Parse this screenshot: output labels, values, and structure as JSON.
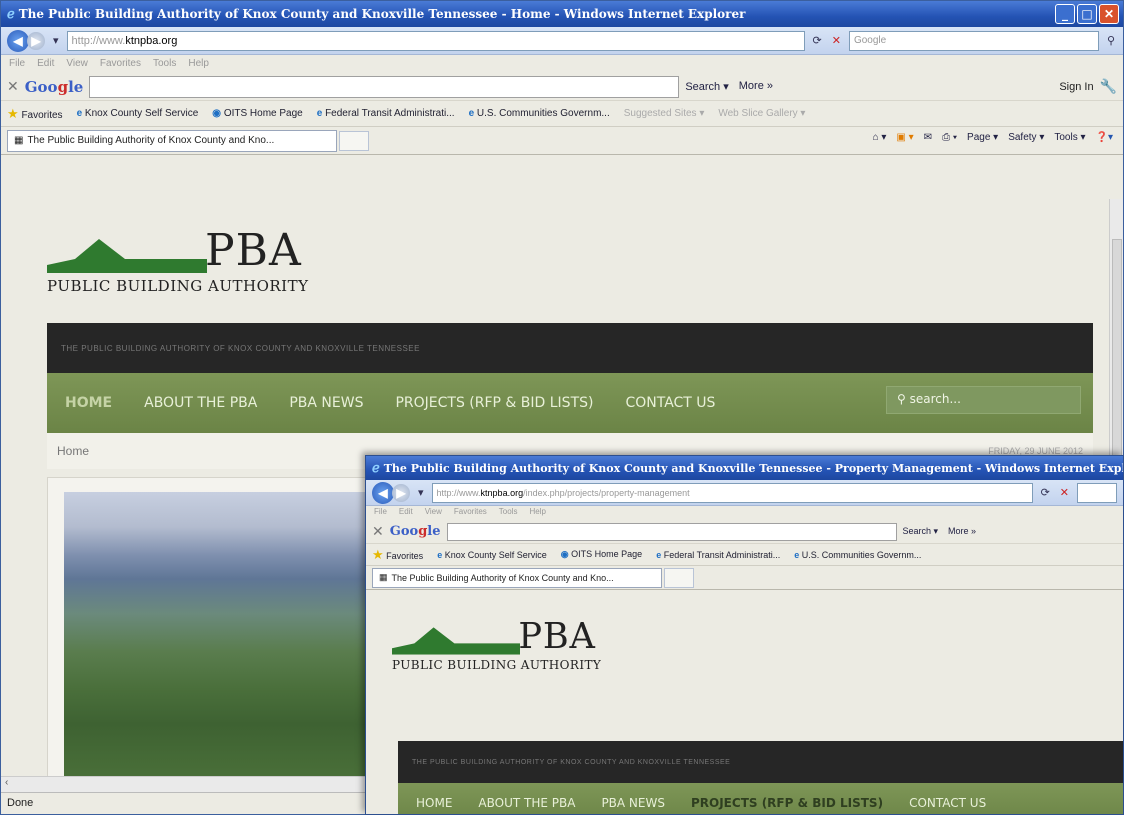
{
  "window1": {
    "title": "The Public Building Authority of Knox County and Knoxville Tennessee - Home - Windows Internet Explorer",
    "url_prefix": "http://www.",
    "url_domain": "ktnpba.org",
    "search_placeholder": "Google",
    "menu": [
      "File",
      "Edit",
      "View",
      "Favorites",
      "Tools",
      "Help"
    ],
    "google_search_label": "Search ▾",
    "google_more_label": "More »",
    "google_signin_label": "Sign In",
    "favorites_label": "Favorites",
    "favorites_items": [
      "Knox County Self Service",
      "OITS Home Page",
      "Federal Transit Administrati...",
      "U.S. Communities Governm...",
      "Suggested Sites ▾",
      "Web Slice Gallery ▾"
    ],
    "tab_title": "The Public Building Authority of Knox County and Kno...",
    "cmd_items": [
      "Page ▾",
      "Safety ▾",
      "Tools ▾"
    ],
    "status": "Done"
  },
  "window2": {
    "title": "The Public Building Authority of Knox County and Knoxville Tennessee - Property Management - Windows Internet Explorer",
    "url_prefix": "http://www.",
    "url_domain": "ktnpba.org",
    "url_suffix": "/index.php/projects/property-management",
    "favorites_items": [
      "Knox County Self Service",
      "OITS Home Page",
      "Federal Transit Administrati...",
      "U.S. Communities Governm..."
    ],
    "tab_title": "The Public Building Authority of Knox County and Kno..."
  },
  "site": {
    "logo_text": "PBA",
    "logo_subtitle": "PUBLIC BUILDING AUTHORITY",
    "tagline": "THE PUBLIC BUILDING AUTHORITY OF KNOX COUNTY AND KNOXVILLE TENNESSEE",
    "nav": [
      "HOME",
      "ABOUT THE PBA",
      "PBA NEWS",
      "PROJECTS (RFP & BID LISTS)",
      "CONTACT US"
    ],
    "search_placeholder": "search...",
    "breadcrumb": "Home",
    "date": "FRIDAY, 29 JUNE 2012"
  },
  "colors": {
    "logo_green": "#2f7a2f",
    "nav_green": "#6b8446",
    "dark_bar": "#262626"
  }
}
